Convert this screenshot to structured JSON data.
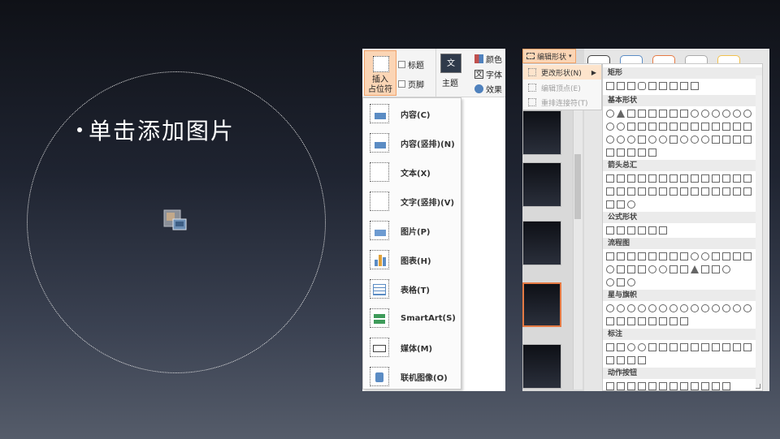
{
  "slide": {
    "bullet_text": "单击添加图片"
  },
  "ribbon": {
    "insert_placeholder": "插入\n占位符",
    "title_check": "标题",
    "footer_check": "页脚",
    "theme_icon_text": "文",
    "theme_label": "主题",
    "colors_label": "颜色",
    "fonts_label": "字体",
    "effects_label": "效果"
  },
  "placeholder_menu": {
    "items": [
      {
        "label": "内容(C)"
      },
      {
        "label": "内容(竖排)(N)"
      },
      {
        "label": "文本(X)"
      },
      {
        "label": "文字(竖排)(V)"
      },
      {
        "label": "图片(P)"
      },
      {
        "label": "图表(H)"
      },
      {
        "label": "表格(T)"
      },
      {
        "label": "SmartArt(S)"
      },
      {
        "label": "媒体(M)"
      },
      {
        "label": "联机图像(O)"
      }
    ]
  },
  "edit_shape": {
    "button_label": "编辑形状",
    "submenu": [
      {
        "label": "更改形状(N)",
        "state": "active"
      },
      {
        "label": "编辑顶点(E)",
        "state": "disabled"
      },
      {
        "label": "重排连接符(T)",
        "state": "disabled"
      }
    ]
  },
  "shape_gallery": {
    "categories": [
      "矩形",
      "基本形状",
      "箭头总汇",
      "公式形状",
      "流程图",
      "星与旗帜",
      "标注",
      "动作按钮"
    ]
  },
  "colors": {
    "accent_orange": "#e57a44",
    "highlight": "#fbd5b5",
    "icon_blue": "#5b8cc4"
  }
}
